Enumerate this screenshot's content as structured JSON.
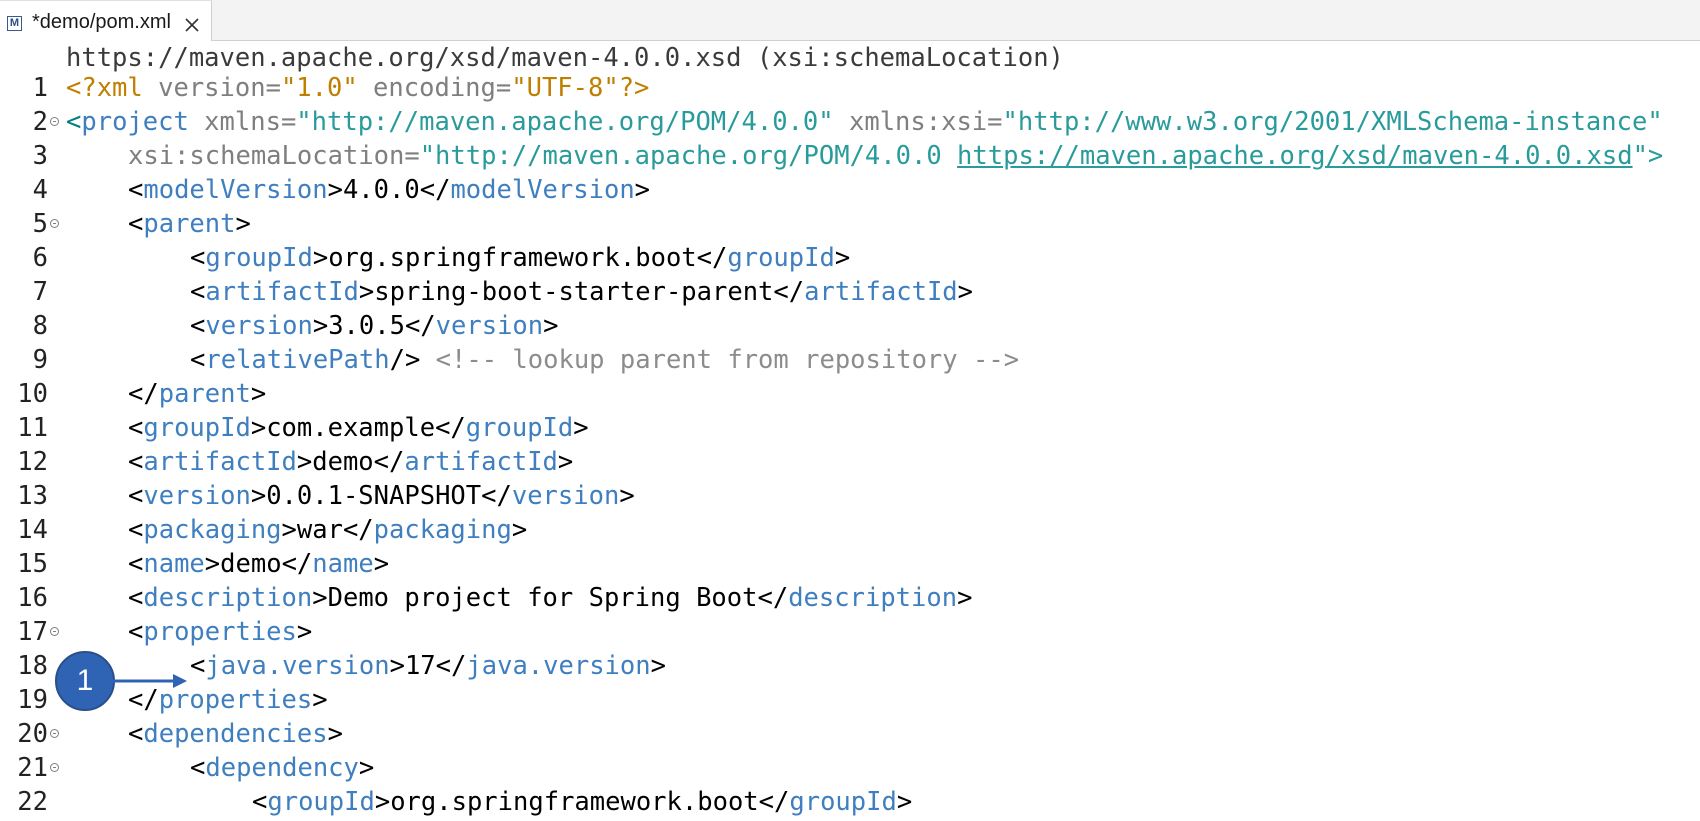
{
  "tab": {
    "icon": "maven-file-icon",
    "icon_letter": "M",
    "title": "*demo/pom.xml",
    "close": "close-icon"
  },
  "editor": {
    "hint": "https://maven.apache.org/xsd/maven-4.0.0.xsd (xsi:schemaLocation)",
    "lines": [
      {
        "n": "1"
      },
      {
        "n": "2"
      },
      {
        "n": "3"
      },
      {
        "n": "4"
      },
      {
        "n": "5"
      },
      {
        "n": "6"
      },
      {
        "n": "7"
      },
      {
        "n": "8"
      },
      {
        "n": "9"
      },
      {
        "n": "10"
      },
      {
        "n": "11"
      },
      {
        "n": "12"
      },
      {
        "n": "13"
      },
      {
        "n": "14"
      },
      {
        "n": "15"
      },
      {
        "n": "16"
      },
      {
        "n": "17"
      },
      {
        "n": "18"
      },
      {
        "n": "19"
      },
      {
        "n": "20"
      },
      {
        "n": "21"
      },
      {
        "n": "22"
      }
    ],
    "text": {
      "l1_xml": "<?xml",
      "l1_version_attr": " version=",
      "l1_version_val": "\"1.0\"",
      "l1_enc_attr": " encoding=",
      "l1_enc_val": "\"UTF-8\"",
      "l1_end": "?>",
      "l2_tag": "project",
      "l2_attr1": " xmlns=",
      "l2_val1": "\"http://maven.apache.org/POM/4.0.0\"",
      "l2_attr2": " xmlns:xsi=",
      "l2_val2": "\"http://www.w3.org/2001/XMLSchema-instance\"",
      "l3_attr": "xsi:schemaLocation=",
      "l3_val1": "\"http://maven.apache.org/POM/4.0.0 ",
      "l3_link": "https://maven.apache.org/xsd/maven-4.0.0.xsd",
      "l3_val2": "\">",
      "modelVersion": "modelVersion",
      "modelVersion_val": "4.0.0",
      "parent": "parent",
      "groupId": "groupId",
      "parent_groupId_val": "org.springframework.boot",
      "artifactId": "artifactId",
      "parent_artifactId_val": "spring-boot-starter-parent",
      "version": "version",
      "parent_version_val": "3.0.5",
      "relativePath": "relativePath",
      "comment": "<!-- lookup parent from repository -->",
      "groupId_val": "com.example",
      "artifactId_val": "demo",
      "version_val": "0.0.1-SNAPSHOT",
      "packaging": "packaging",
      "packaging_val": "war",
      "name": "name",
      "name_val": "demo",
      "description": "description",
      "description_val": "Demo project for Spring Boot",
      "properties": "properties",
      "java_version": "java.version",
      "java_version_val": "17",
      "dependencies": "dependencies",
      "dependency": "dependency",
      "dep_groupId_val": "org.springframework.boot"
    }
  },
  "callout": {
    "number": "1",
    "color": "#2f64b4"
  }
}
